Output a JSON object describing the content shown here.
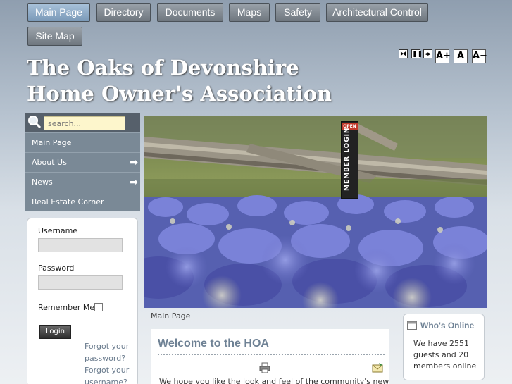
{
  "nav": {
    "items": [
      {
        "label": "Main Page",
        "active": true
      },
      {
        "label": "Directory"
      },
      {
        "label": "Documents"
      },
      {
        "label": "Maps"
      },
      {
        "label": "Safety"
      },
      {
        "label": "Architectural Control"
      },
      {
        "label": "Site Map"
      }
    ]
  },
  "tools": {
    "icons": [
      "fit-width-icon",
      "pause-icon",
      "toggle-width-icon",
      "font-increase-icon",
      "font-reset-icon",
      "font-decrease-icon"
    ],
    "small": [
      "⧓",
      "❚❚",
      "◂▸"
    ],
    "font": [
      "A+",
      "A",
      "A−"
    ]
  },
  "site": {
    "title_line1": "The Oaks of Devonshire",
    "title_line2": "Home Owner's Association"
  },
  "search": {
    "placeholder": "search..."
  },
  "menu": {
    "items": [
      {
        "label": "Main Page",
        "arrow": false
      },
      {
        "label": "About Us",
        "arrow": true
      },
      {
        "label": "News",
        "arrow": true
      },
      {
        "label": "Real Estate Corner",
        "arrow": false
      }
    ]
  },
  "login": {
    "username_label": "Username",
    "password_label": "Password",
    "remember_label": "Remember Me",
    "button": "Login",
    "forgot_password": "Forgot your password?",
    "forgot_username": "Forgot your username?"
  },
  "member_tab": {
    "open": "OPEN",
    "label": "MEMBER LOGIN"
  },
  "breadcrumb": "Main Page",
  "article": {
    "title": "Welcome to the HOA",
    "intro": "We hope you like the look and feel of the community's new"
  },
  "whos_online": {
    "title": "Who's Online",
    "text": "We have 2551 guests and 20 members online"
  },
  "colors": {
    "nav_active": "#8aa8c6",
    "menu_bg": "#7a8996",
    "heading": "#6f8295"
  }
}
